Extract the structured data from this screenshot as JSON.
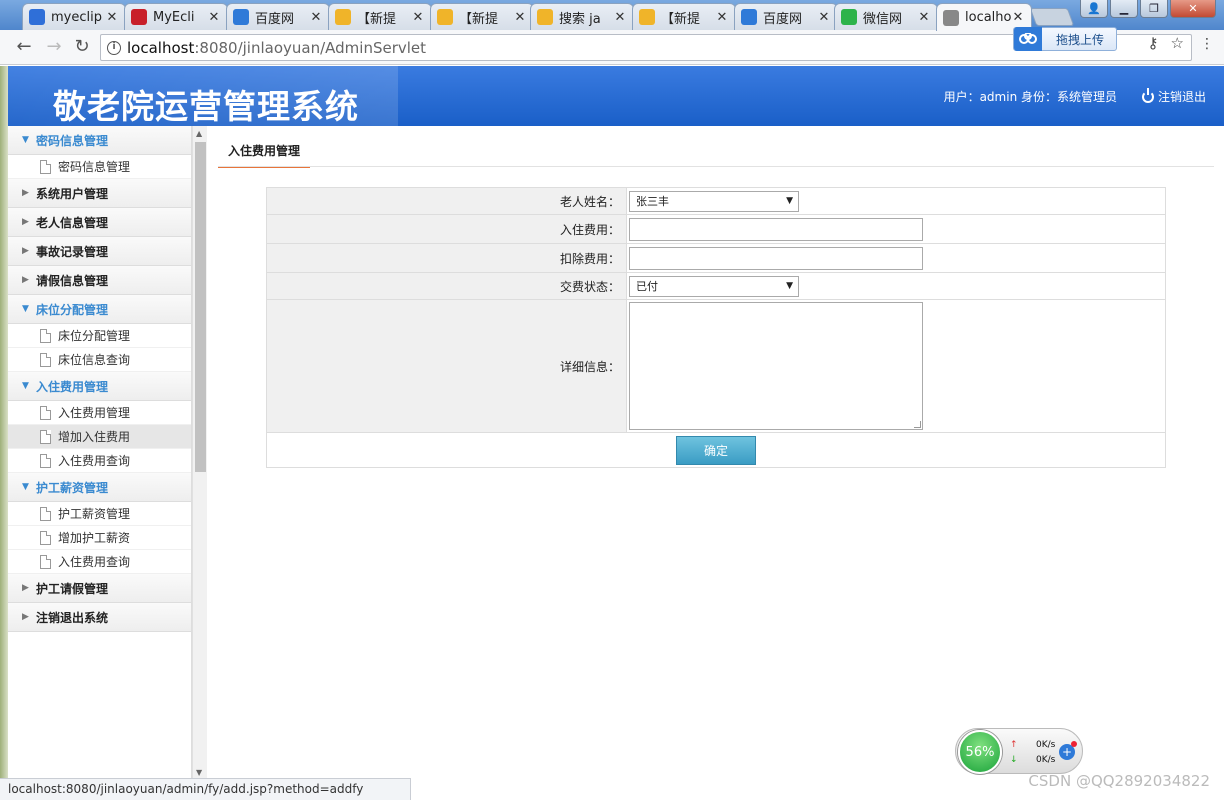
{
  "browser": {
    "tabs": [
      {
        "label": "myeclip",
        "icon": "baidu-paw-icon",
        "color": "#2f6fd8"
      },
      {
        "label": "MyEcli",
        "icon": "csdn-c-icon",
        "color": "#c8202a"
      },
      {
        "label": "百度网",
        "icon": "baidu-cloud-icon",
        "color": "#2f7ad8"
      },
      {
        "label": "【新提",
        "icon": "speech-bubble-icon",
        "color": "#f0b429"
      },
      {
        "label": "【新提",
        "icon": "speech-bubble-icon",
        "color": "#f0b429"
      },
      {
        "label": "搜索 ja",
        "icon": "speech-bubble-icon",
        "color": "#f0b429"
      },
      {
        "label": "【新提",
        "icon": "speech-bubble-icon",
        "color": "#f0b429"
      },
      {
        "label": "百度网",
        "icon": "baidu-cloud-icon",
        "color": "#2f7ad8"
      },
      {
        "label": "微信网",
        "icon": "wechat-icon",
        "color": "#2db34a"
      },
      {
        "label": "localho",
        "icon": "page-icon",
        "color": "#888888",
        "active": true
      }
    ],
    "close_glyph": "✕",
    "url_host": "localhost",
    "url_path": ":8080/jinlaoyuan/AdminServlet",
    "upload_label": "拖拽上传",
    "status_url": "localhost:8080/jinlaoyuan/admin/fy/add.jsp?method=addfy"
  },
  "app": {
    "title": "敬老院运营管理系统",
    "user_info": "用户：admin 身份：系统管理员",
    "logout_label": "注销退出"
  },
  "sidebar": {
    "groups": [
      {
        "label": "密码信息管理",
        "open": true,
        "items": [
          {
            "label": "密码信息管理"
          }
        ]
      },
      {
        "label": "系统用户管理",
        "open": false,
        "items": []
      },
      {
        "label": "老人信息管理",
        "open": false,
        "items": []
      },
      {
        "label": "事故记录管理",
        "open": false,
        "items": []
      },
      {
        "label": "请假信息管理",
        "open": false,
        "items": []
      },
      {
        "label": "床位分配管理",
        "open": true,
        "items": [
          {
            "label": "床位分配管理"
          },
          {
            "label": "床位信息查询"
          }
        ]
      },
      {
        "label": "入住费用管理",
        "open": true,
        "items": [
          {
            "label": "入住费用管理"
          },
          {
            "label": "增加入住费用",
            "selected": true
          },
          {
            "label": "入住费用查询"
          }
        ]
      },
      {
        "label": "护工薪资管理",
        "open": true,
        "items": [
          {
            "label": "护工薪资管理"
          },
          {
            "label": "增加护工薪资"
          },
          {
            "label": "入住费用查询"
          }
        ]
      },
      {
        "label": "护工请假管理",
        "open": false,
        "items": []
      },
      {
        "label": "注销退出系统",
        "open": false,
        "items": []
      }
    ]
  },
  "main": {
    "tab_title": "入住费用管理",
    "form": {
      "elder_name_label": "老人姓名：",
      "elder_name_value": "张三丰",
      "fee_label": "入住费用：",
      "fee_value": "",
      "deduct_label": "扣除费用：",
      "deduct_value": "",
      "status_label": "交费状态：",
      "status_value": "已付",
      "detail_label": "详细信息：",
      "detail_value": "",
      "submit_label": "确定"
    }
  },
  "widget": {
    "percent": "56%",
    "up_speed": "0K/s",
    "down_speed": "0K/s"
  },
  "watermark": "CSDN @QQ2892034822"
}
